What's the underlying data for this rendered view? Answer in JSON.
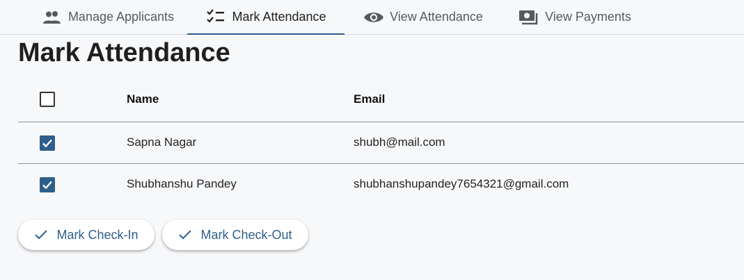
{
  "tabs": [
    {
      "label": "Manage Applicants",
      "icon": "people-icon"
    },
    {
      "label": "Mark Attendance",
      "icon": "checklist-icon",
      "active": true
    },
    {
      "label": "View Attendance",
      "icon": "eye-icon"
    },
    {
      "label": "View Payments",
      "icon": "payments-icon"
    }
  ],
  "page": {
    "title": "Mark Attendance"
  },
  "table": {
    "headers": {
      "name": "Name",
      "email": "Email"
    },
    "select_all_checked": false,
    "rows": [
      {
        "name": "Sapna Nagar",
        "email": "shubh@mail.com",
        "checked": true
      },
      {
        "name": "Shubhanshu Pandey",
        "email": "shubhanshupandey7654321@gmail.com",
        "checked": true
      }
    ]
  },
  "actions": {
    "check_in": "Mark Check-In",
    "check_out": "Mark Check-Out"
  },
  "colors": {
    "accent": "#2d5f8a",
    "background": "#f7f8fa",
    "icon_gray": "#555a60"
  }
}
